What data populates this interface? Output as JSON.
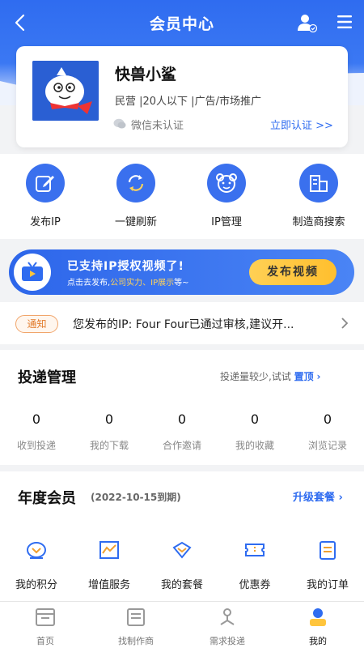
{
  "header": {
    "title": "会员中心"
  },
  "profile": {
    "company_name": "快兽小鲨",
    "meta": "民营 |20人以下 |广告/市场推广",
    "wechat_status": "微信未认证",
    "certify_link": "立即认证 >>"
  },
  "quick_actions": [
    {
      "label": "发布IP",
      "icon": "edit-icon"
    },
    {
      "label": "一键刷新",
      "icon": "refresh-icon"
    },
    {
      "label": "IP管理",
      "icon": "bear-icon"
    },
    {
      "label": "制造商搜索",
      "icon": "building-icon"
    }
  ],
  "banner": {
    "title": "已支持IP授权视频了!",
    "sub_prefix": "点击去发布,",
    "sub_highlight": "公司实力、IP展示",
    "sub_suffix": "等~",
    "button": "发布视频"
  },
  "notice": {
    "badge": "通知",
    "text": "您发布的IP: Four Four已通过审核,建议开..."
  },
  "delivery": {
    "title": "投递管理",
    "hint_prefix": "投递量较少,试试",
    "hint_link": "置顶",
    "stats": [
      {
        "value": "0",
        "label": "收到投递"
      },
      {
        "value": "0",
        "label": "我的下载"
      },
      {
        "value": "0",
        "label": "合作邀请"
      },
      {
        "value": "0",
        "label": "我的收藏"
      },
      {
        "value": "0",
        "label": "浏览记录"
      }
    ]
  },
  "annual": {
    "title": "年度会员",
    "expire": "(2022-10-15到期)",
    "upgrade": "升级套餐",
    "services": [
      {
        "label": "我的积分",
        "icon": "points-icon"
      },
      {
        "label": "增值服务",
        "icon": "chart-icon"
      },
      {
        "label": "我的套餐",
        "icon": "package-icon"
      },
      {
        "label": "优惠券",
        "icon": "coupon-icon"
      },
      {
        "label": "我的订单",
        "icon": "order-icon"
      }
    ]
  },
  "tabs": [
    {
      "label": "首页",
      "icon": "home-icon"
    },
    {
      "label": "找制作商",
      "icon": "factory-icon"
    },
    {
      "label": "需求投递",
      "icon": "request-icon"
    },
    {
      "label": "我的",
      "icon": "profile-icon",
      "active": true
    }
  ],
  "colors": {
    "primary": "#2f6cf0",
    "accent": "#ffc53d",
    "notice": "#e27b2b"
  }
}
